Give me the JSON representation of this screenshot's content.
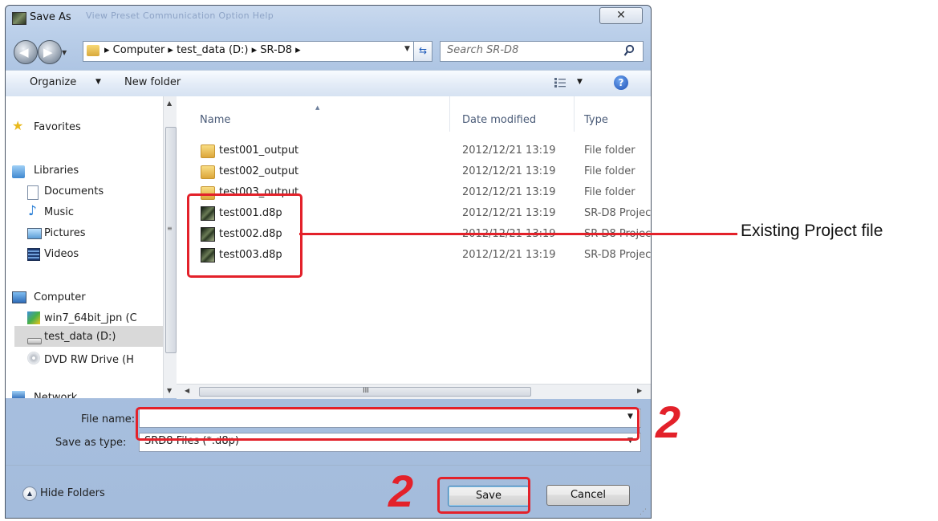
{
  "window": {
    "title": "Save As",
    "background_menu": "View    Preset    Communication    Option    Help",
    "close_glyph": "✕"
  },
  "address_bar": {
    "path": "▸ Computer ▸ test_data (D:) ▸ SR-D8 ▸",
    "search_placeholder": "Search SR-D8"
  },
  "toolbar": {
    "organize_label": "Organize",
    "new_folder_label": "New folder"
  },
  "nav_pane": {
    "favorites": "Favorites",
    "libraries": "Libraries",
    "documents": "Documents",
    "music": "Music",
    "pictures": "Pictures",
    "videos": "Videos",
    "computer": "Computer",
    "drive_c": "win7_64bit_jpn (C",
    "drive_d": "test_data (D:)",
    "drive_dvd": "DVD RW Drive (H",
    "network": "Network"
  },
  "file_list": {
    "columns": {
      "name": "Name",
      "date": "Date modified",
      "type": "Type"
    },
    "rows": [
      {
        "name": "test001_output",
        "date": "2012/12/21 13:19",
        "type": "File folder",
        "icon": "folder-icon"
      },
      {
        "name": "test002_output",
        "date": "2012/12/21 13:19",
        "type": "File folder",
        "icon": "folder-icon"
      },
      {
        "name": "test003_output",
        "date": "2012/12/21 13:19",
        "type": "File folder",
        "icon": "folder-icon"
      },
      {
        "name": "test001.d8p",
        "date": "2012/12/21 13:19",
        "type": "SR-D8 Projec",
        "icon": "d8p-file-icon"
      },
      {
        "name": "test002.d8p",
        "date": "2012/12/21 13:19",
        "type": "SR-D8 Projec",
        "icon": "d8p-file-icon"
      },
      {
        "name": "test003.d8p",
        "date": "2012/12/21 13:19",
        "type": "SR-D8 Projec",
        "icon": "d8p-file-icon"
      }
    ]
  },
  "form": {
    "file_name_label": "File name:",
    "file_name_value": "",
    "save_type_label": "Save as type:",
    "save_type_value": "SRD8 Files (*.d8p)"
  },
  "footer": {
    "hide_folders_label": "Hide Folders",
    "save_label": "Save",
    "cancel_label": "Cancel"
  },
  "annotations": {
    "existing_label": "Existing Project file",
    "step_file_name": "2",
    "step_save": "2",
    "color": "#e3212a"
  }
}
